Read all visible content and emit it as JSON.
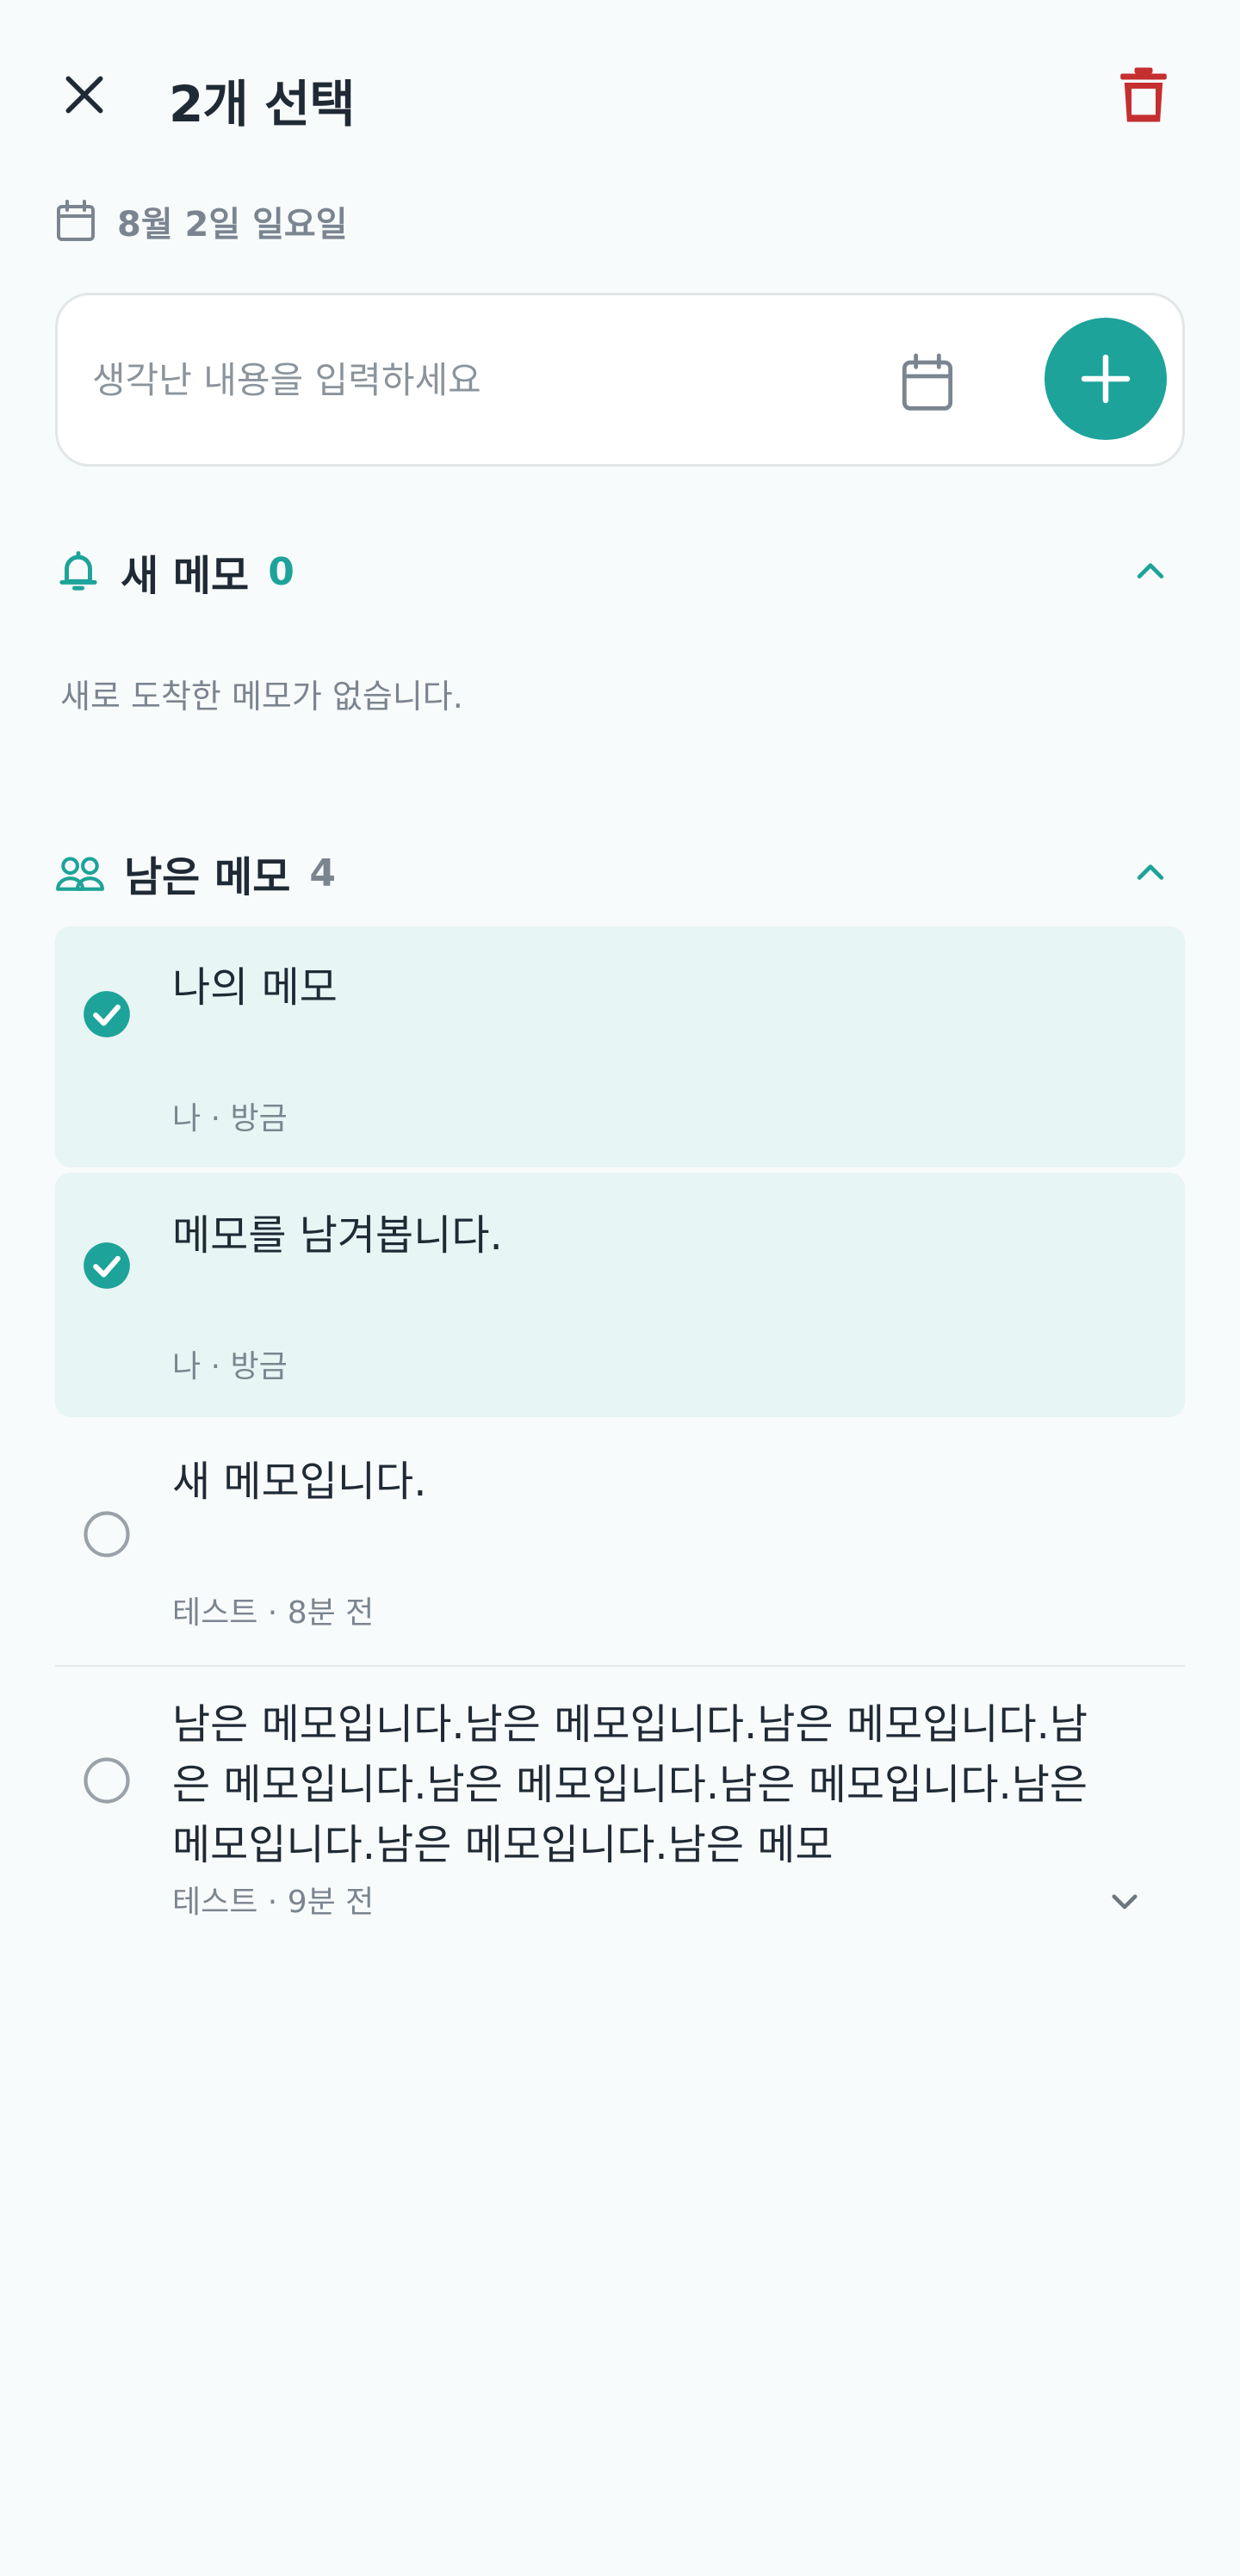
{
  "header": {
    "title": "2개 선택",
    "close_icon": "close-icon",
    "delete_icon": "trash-icon",
    "delete_color": "#c62f2f"
  },
  "date": {
    "label": "8월 2일 일요일",
    "icon": "calendar-icon"
  },
  "input": {
    "placeholder": "생각난 내용을 입력하세요",
    "value": "",
    "calendar_icon": "calendar-icon",
    "add_icon": "plus-icon"
  },
  "accent": "#1da39a",
  "sections": {
    "new": {
      "title": "새 메모",
      "count": "0",
      "empty_text": "새로 도착한 메모가 없습니다.",
      "icon": "bell-icon",
      "expanded": true
    },
    "remaining": {
      "title": "남은 메모",
      "count": "4",
      "icon": "people-icon",
      "expanded": true
    }
  },
  "memos": [
    {
      "text": "나의 메모",
      "meta": "나 · 방금",
      "selected": true
    },
    {
      "text": "메모를 남겨봅니다.",
      "meta": "나 · 방금",
      "selected": true
    },
    {
      "text": "새 메모입니다.",
      "meta": "테스트 · 8분 전",
      "selected": false
    },
    {
      "text": "남은 메모입니다.남은 메모입니다.남은 메모입니다.남은 메모입니다.남은 메모입니다.남은 메모입니다.남은 메모입니다.남은 메모입니다.남은 메모",
      "meta": "테스트 · 9분 전",
      "selected": false,
      "truncated": true
    }
  ]
}
